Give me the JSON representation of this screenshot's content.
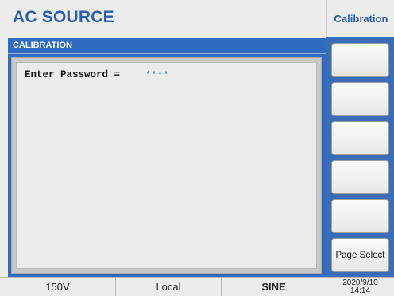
{
  "header": {
    "app_title": "AC SOURCE",
    "mode_title": "Calibration"
  },
  "panel": {
    "title": "CALIBRATION",
    "password_label": "Enter Password =",
    "password_value": "****"
  },
  "softkeys": [
    "",
    "",
    "",
    "",
    "",
    "Page Select"
  ],
  "status": {
    "range": "150V",
    "remote": "Local",
    "waveform": "SINE",
    "date": "2020/9/10",
    "time": "14:14"
  },
  "colors": {
    "accent": "#2b5faa",
    "panel_blue": "#2f6bc0",
    "background": "#ececea"
  }
}
